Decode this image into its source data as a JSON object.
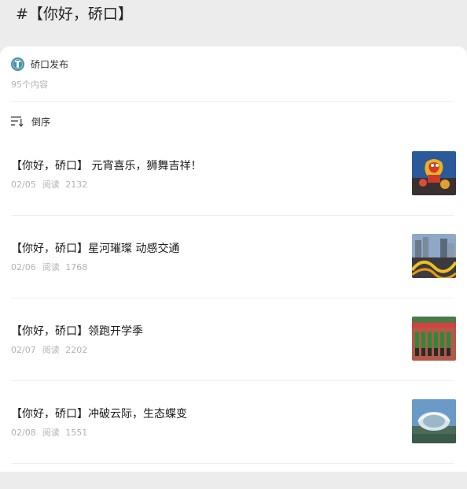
{
  "header": {
    "topic_title": "#【你好，硚口】"
  },
  "account": {
    "name": "硚口发布",
    "count": "95个内容",
    "avatar_icon": "account-logo-icon"
  },
  "sort": {
    "label": "倒序",
    "icon": "sort-descending-icon"
  },
  "articles": [
    {
      "title": "【你好，硚口】 元宵喜乐，狮舞吉祥！",
      "date": "02/05",
      "read_label": "阅读",
      "read_count": "2132"
    },
    {
      "title": "【你好，硚口】星河璀璨 动感交通",
      "date": "02/06",
      "read_label": "阅读",
      "read_count": "1768"
    },
    {
      "title": "【你好，硚口】领跑开学季",
      "date": "02/07",
      "read_label": "阅读",
      "read_count": "2202"
    },
    {
      "title": "【你好，硚口】冲破云际，生态蝶变",
      "date": "02/08",
      "read_label": "阅读",
      "read_count": "1551"
    }
  ]
}
